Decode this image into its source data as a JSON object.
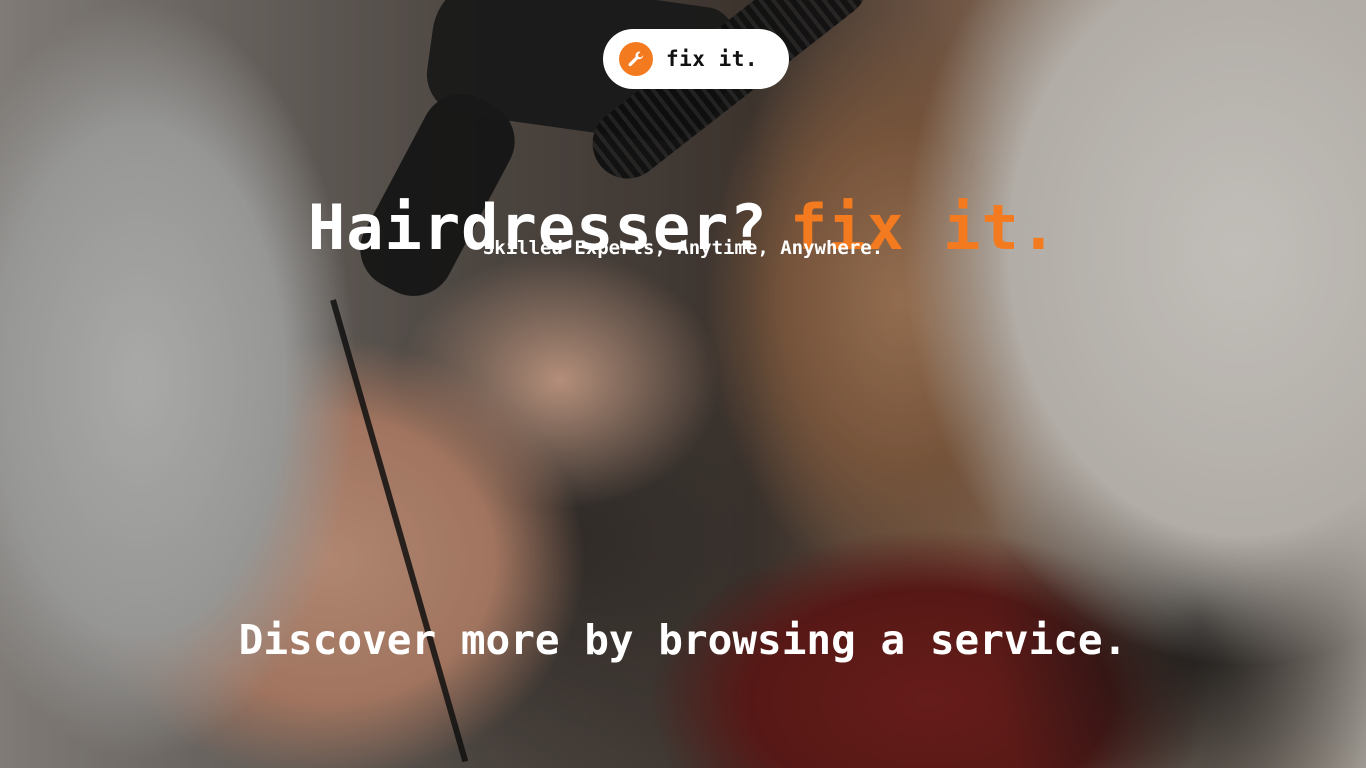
{
  "logo": {
    "icon": "wrench-icon",
    "text": "fix it."
  },
  "hero": {
    "headline_primary": "Hairdresser?",
    "headline_accent": "fix it.",
    "tagline": "Skilled Experts, Anytime, Anywhere.",
    "cta_text": "Discover more by browsing a service."
  },
  "colors": {
    "accent": "#f47a20",
    "text": "#ffffff",
    "logo_bg": "#ffffff"
  }
}
